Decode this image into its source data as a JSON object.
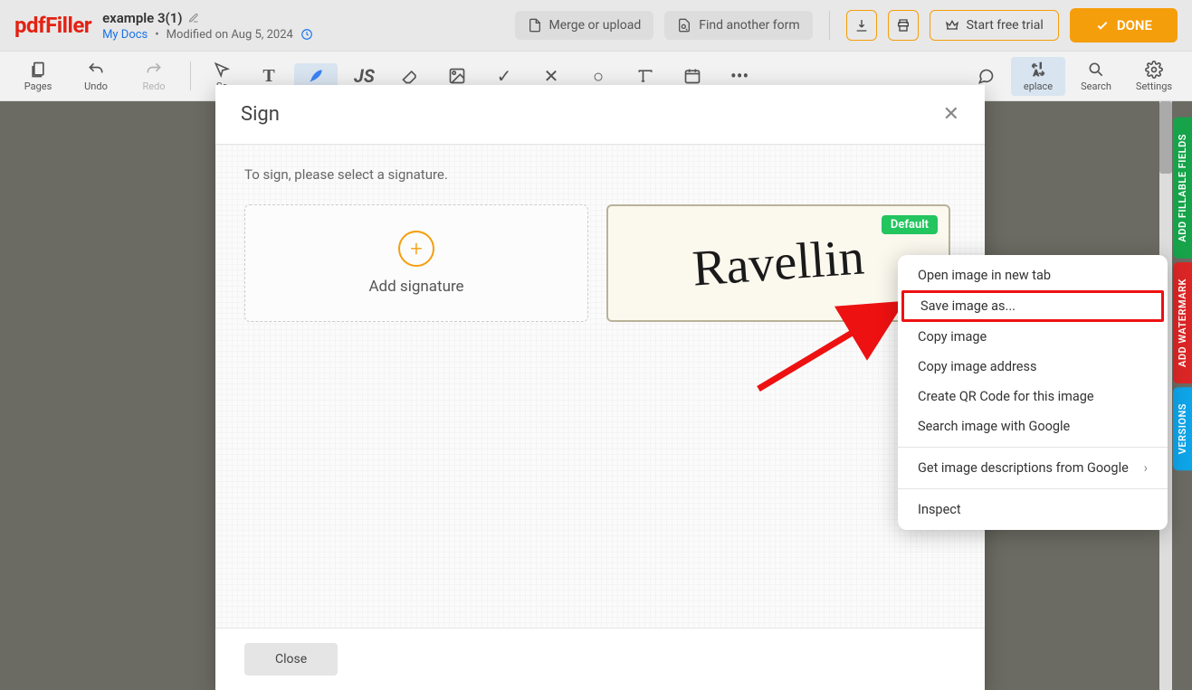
{
  "logo": "pdfFiller",
  "doc": {
    "title": "example 3(1)",
    "mydocs": "My Docs",
    "modified": "Modified on Aug 5, 2024"
  },
  "header_buttons": {
    "merge": "Merge or upload",
    "find": "Find another form",
    "trial": "Start free trial",
    "done": "DONE"
  },
  "toolbar": {
    "pages": "Pages",
    "undo": "Undo",
    "redo": "Redo",
    "select": "Se",
    "replace": "eplace",
    "search": "Search",
    "settings": "Settings"
  },
  "right_tabs": {
    "fields": "ADD FILLABLE FIELDS",
    "watermark": "ADD WATERMARK",
    "versions": "VERSIONS"
  },
  "modal": {
    "title": "Sign",
    "instruction": "To sign, please select a signature.",
    "add": "Add signature",
    "default_badge": "Default",
    "signature_name": "Ravellin",
    "close": "Close"
  },
  "context_menu": {
    "items": [
      "Open image in new tab",
      "Save image as...",
      "Copy image",
      "Copy image address",
      "Create QR Code for this image",
      "Search image with Google"
    ],
    "more": "Get image descriptions from Google",
    "inspect": "Inspect"
  }
}
